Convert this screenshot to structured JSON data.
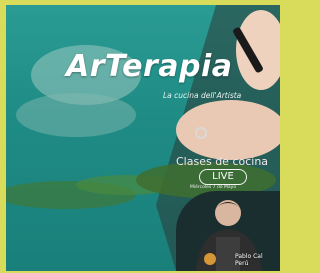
{
  "poster": {
    "title": "ArTerapia",
    "subtitle": "La cucina dell'Artista",
    "event_label": "Clases de cocina",
    "live_label": "LIVE",
    "date_text": "Miércoles 7 de Mayo",
    "chef_name_line1": "Pablo Cal",
    "chef_name_line2": "Perú"
  },
  "colors": {
    "frame": "#d8dc5a",
    "teal": "#1f8c85",
    "title": "#ffffff"
  }
}
